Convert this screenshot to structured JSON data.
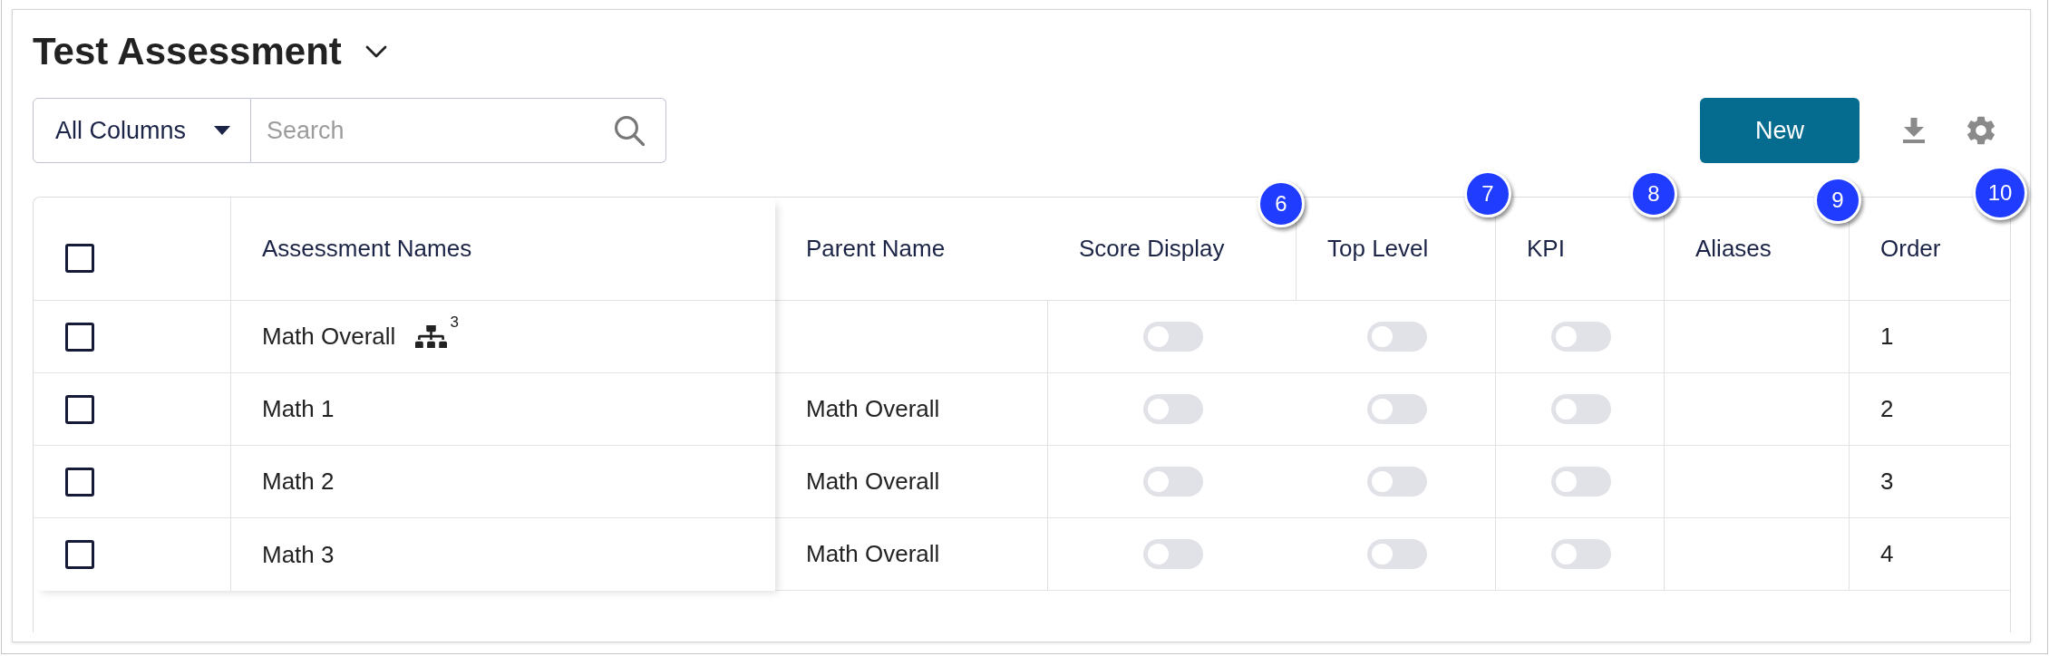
{
  "page": {
    "title": "Test Assessment"
  },
  "toolbar": {
    "column_filter": {
      "value": "All Columns"
    },
    "search": {
      "placeholder": "Search"
    },
    "new_button": {
      "label": "New"
    }
  },
  "table": {
    "select_all": {
      "checked": false
    },
    "columns": [
      {
        "label": "Assessment Names"
      },
      {
        "label": "Parent Name"
      },
      {
        "label": "Score Display"
      },
      {
        "label": "Top Level"
      },
      {
        "label": "KPI"
      },
      {
        "label": "Aliases"
      },
      {
        "label": "Order"
      }
    ],
    "rows": [
      {
        "checked": false,
        "name": "Math Overall",
        "child_count": "3",
        "score_display": {
          "on": false
        },
        "top_level": {
          "on": false
        },
        "kpi": {
          "on": false
        },
        "order": "1"
      },
      {
        "checked": false,
        "name": "Math 1",
        "parent_name": "Math Overall",
        "score_display": {
          "on": false
        },
        "top_level": {
          "on": false
        },
        "kpi": {
          "on": false
        },
        "order": "2"
      },
      {
        "checked": false,
        "name": "Math 2",
        "parent_name": "Math Overall",
        "score_display": {
          "on": false
        },
        "top_level": {
          "on": false
        },
        "kpi": {
          "on": false
        },
        "order": "3"
      },
      {
        "checked": false,
        "name": "Math 3",
        "parent_name": "Math Overall",
        "score_display": {
          "on": false
        },
        "top_level": {
          "on": false
        },
        "kpi": {
          "on": false
        },
        "order": "4"
      }
    ]
  },
  "callouts": [
    {
      "label": "6"
    },
    {
      "label": "7"
    },
    {
      "label": "8"
    },
    {
      "label": "9"
    },
    {
      "label": "10"
    }
  ]
}
